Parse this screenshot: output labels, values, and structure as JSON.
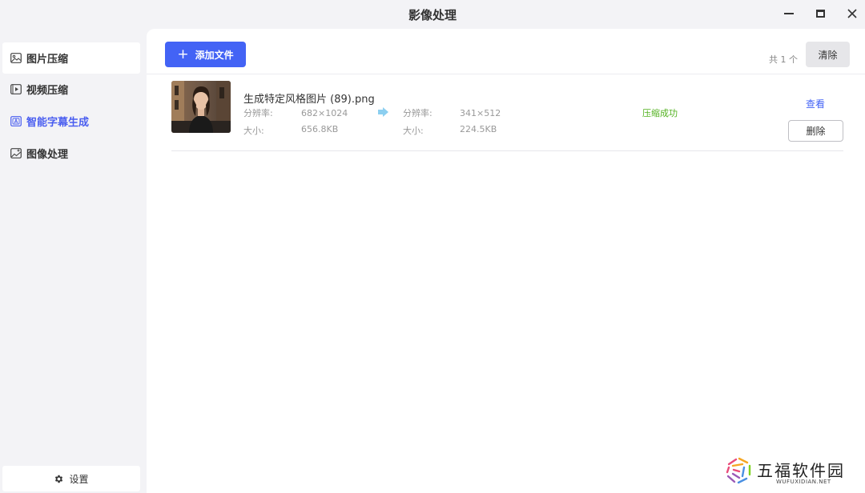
{
  "window": {
    "title": "影像处理"
  },
  "sidebar": {
    "items": [
      {
        "label": "图片压缩",
        "icon": "image-icon"
      },
      {
        "label": "视频压缩",
        "icon": "video-icon"
      },
      {
        "label": "智能字幕生成",
        "icon": "subtitle-icon"
      },
      {
        "label": "图像处理",
        "icon": "image-edit-icon"
      }
    ],
    "settings_label": "设置"
  },
  "toolbar": {
    "add_label": "添加文件",
    "count_text": "共 1 个",
    "clear_label": "清除"
  },
  "files": [
    {
      "name": "生成特定风格图片 (89).png",
      "resolution_label": "分辨率:",
      "size_label": "大小:",
      "original_resolution": "682×1024",
      "original_size": "656.8KB",
      "compressed_resolution": "341×512",
      "compressed_size": "224.5KB",
      "status": "压缩成功",
      "view_label": "查看",
      "delete_label": "删除"
    }
  ],
  "watermark": {
    "name": "五福软件园",
    "url": "WUFUXIDIAN.NET"
  },
  "colors": {
    "accent": "#4363f5",
    "active_nav": "#4a5ef0",
    "success": "#52b11f",
    "sidebar_bg": "#f3f3f6"
  }
}
